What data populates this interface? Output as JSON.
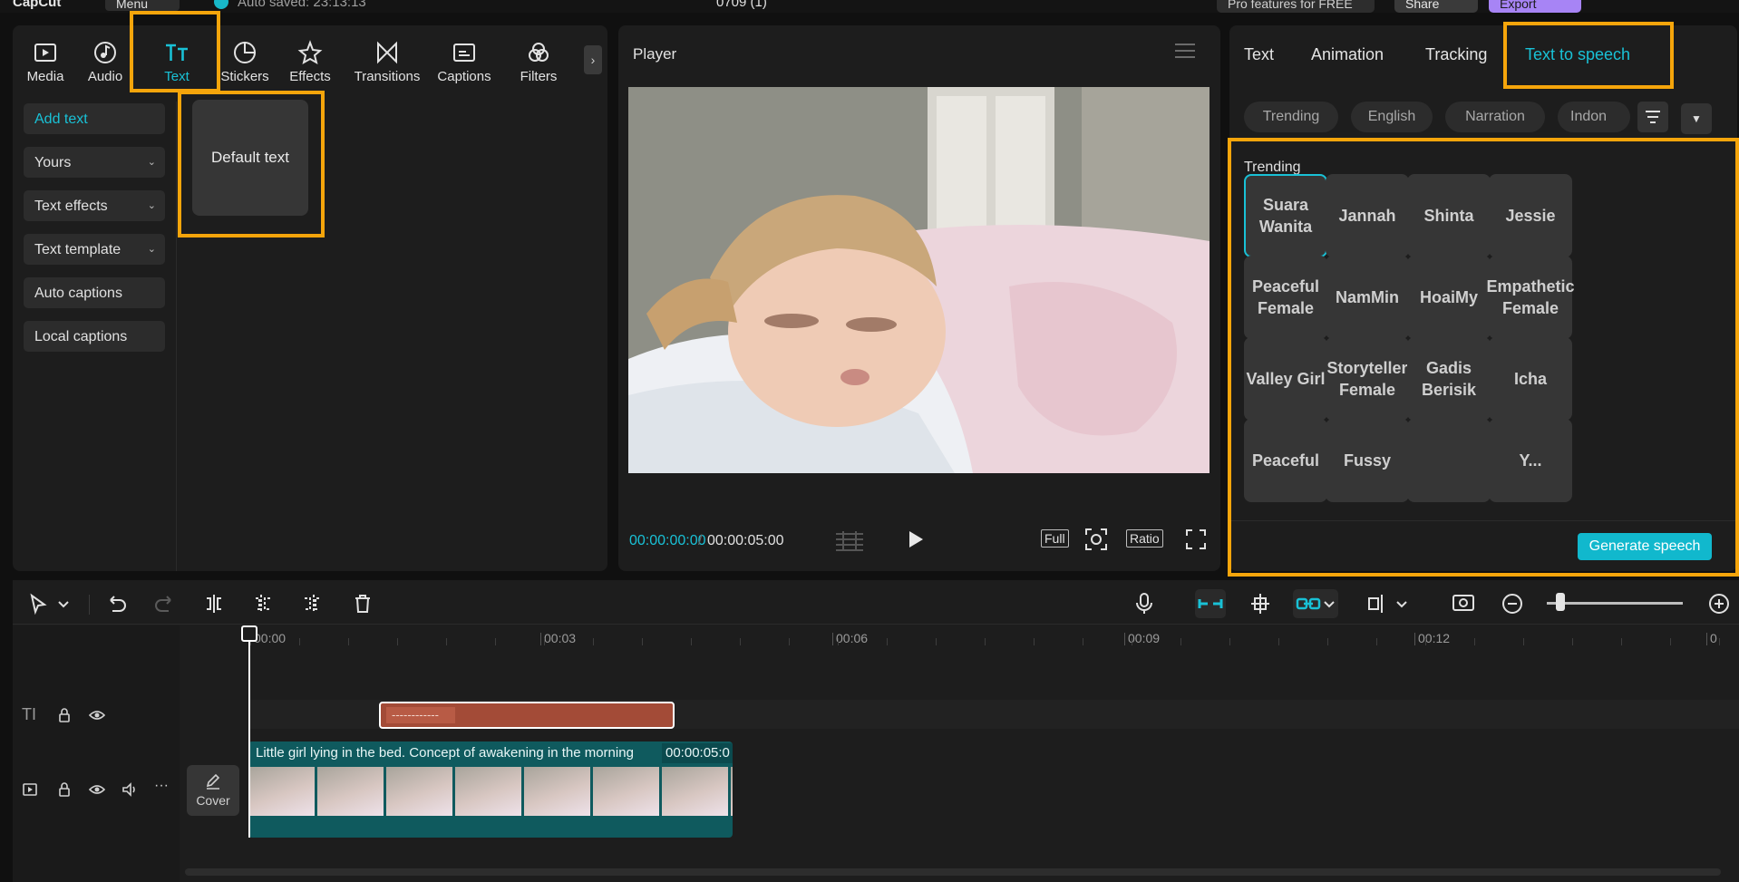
{
  "topbar": {
    "logo": "CapCut",
    "menu": "Menu",
    "autosave": "Auto saved: 23:13:13",
    "project_name": "0709 (1)",
    "pro": "Pro features for FREE",
    "share": "Share",
    "export": "Export"
  },
  "left": {
    "tabs": [
      {
        "label": "Media",
        "icon": "media-icon"
      },
      {
        "label": "Audio",
        "icon": "audio-icon"
      },
      {
        "label": "Text",
        "icon": "text-icon"
      },
      {
        "label": "Stickers",
        "icon": "stickers-icon"
      },
      {
        "label": "Effects",
        "icon": "effects-icon"
      },
      {
        "label": "Transitions",
        "icon": "transitions-icon"
      },
      {
        "label": "Captions",
        "icon": "captions-icon"
      },
      {
        "label": "Filters",
        "icon": "filters-icon"
      }
    ],
    "active_tab": "Text",
    "side": [
      "Add text",
      "Yours",
      "Text effects",
      "Text template",
      "Auto captions",
      "Local captions"
    ],
    "default_text": "Default text"
  },
  "player": {
    "title": "Player",
    "current_time": "00:00:00:00",
    "separator": "/",
    "total_time": "00:00:05:00",
    "full": "Full",
    "ratio": "Ratio"
  },
  "right": {
    "tabs": [
      "Text",
      "Animation",
      "Tracking",
      "Text to speech"
    ],
    "active_tab": "Text to speech",
    "chips": [
      "Trending",
      "English",
      "Narration",
      "Indon"
    ],
    "section": "Trending",
    "voices": [
      [
        "Suara",
        "Wanita"
      ],
      [
        "Jannah"
      ],
      [
        "Shinta"
      ],
      [
        "Jessie"
      ],
      [
        "Peaceful",
        "Female"
      ],
      [
        "NamMin"
      ],
      [
        "HoaiMy"
      ],
      [
        "Empathetic",
        "Female"
      ],
      [
        "Valley Girl"
      ],
      [
        "Storyteller",
        "Female"
      ],
      [
        "Gadis",
        "Berisik"
      ],
      [
        "Icha"
      ],
      [
        "Peaceful"
      ],
      [
        "Fussy"
      ],
      [
        ""
      ],
      [
        "Y..."
      ]
    ],
    "selected_voice": 0,
    "generate": "Generate speech"
  },
  "timeline": {
    "ruler": [
      "00:00",
      "00:03",
      "00:06",
      "00:09",
      "00:12",
      "0"
    ],
    "text_clip": "------------",
    "video_clip_title": "Little girl lying in the bed. Concept of awakening in the morning",
    "video_clip_duration": "00:00:05:0",
    "cover": "Cover"
  },
  "colors": {
    "accent": "#19c1d6",
    "highlight": "#f5a50b",
    "export": "#a784f5",
    "text_clip": "#a34b37",
    "video_clip": "#0f5a5e"
  }
}
